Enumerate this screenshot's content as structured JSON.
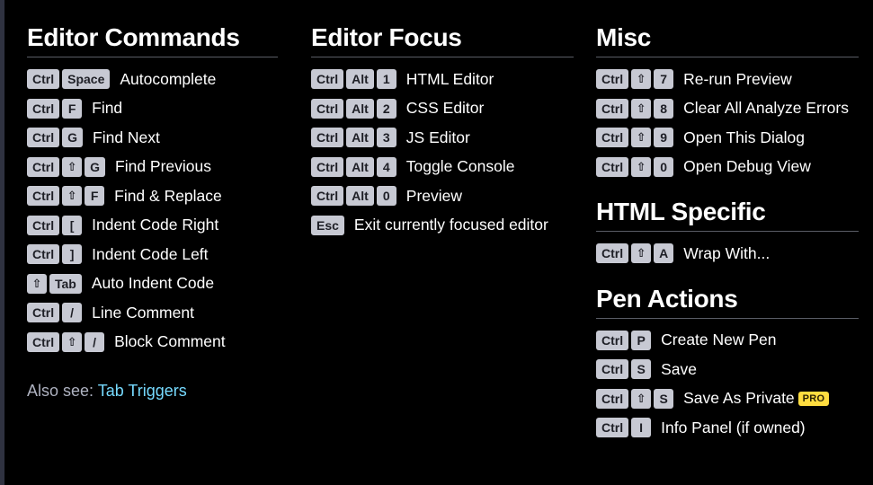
{
  "colors": {
    "background": "#000000",
    "key_bg": "#c7c9d3",
    "key_text": "#1e1f26",
    "link": "#76daff",
    "pro_badge": "#ffdd40"
  },
  "sections": {
    "editor_commands": {
      "title": "Editor Commands",
      "rows": [
        {
          "keys": [
            "Ctrl",
            "Space"
          ],
          "label": "Autocomplete"
        },
        {
          "keys": [
            "Ctrl",
            "F"
          ],
          "label": "Find"
        },
        {
          "keys": [
            "Ctrl",
            "G"
          ],
          "label": "Find Next"
        },
        {
          "keys": [
            "Ctrl",
            "⇧",
            "G"
          ],
          "label": "Find Previous"
        },
        {
          "keys": [
            "Ctrl",
            "⇧",
            "F"
          ],
          "label": "Find & Replace"
        },
        {
          "keys": [
            "Ctrl",
            "["
          ],
          "label": "Indent Code Right"
        },
        {
          "keys": [
            "Ctrl",
            "]"
          ],
          "label": "Indent Code Left"
        },
        {
          "keys": [
            "⇧",
            "Tab"
          ],
          "label": "Auto Indent Code"
        },
        {
          "keys": [
            "Ctrl",
            "/"
          ],
          "label": "Line Comment"
        },
        {
          "keys": [
            "Ctrl",
            "⇧",
            "/"
          ],
          "label": "Block Comment"
        }
      ]
    },
    "editor_focus": {
      "title": "Editor Focus",
      "rows": [
        {
          "keys": [
            "Ctrl",
            "Alt",
            "1"
          ],
          "label": "HTML Editor"
        },
        {
          "keys": [
            "Ctrl",
            "Alt",
            "2"
          ],
          "label": "CSS Editor"
        },
        {
          "keys": [
            "Ctrl",
            "Alt",
            "3"
          ],
          "label": "JS Editor"
        },
        {
          "keys": [
            "Ctrl",
            "Alt",
            "4"
          ],
          "label": "Toggle Console"
        },
        {
          "keys": [
            "Ctrl",
            "Alt",
            "0"
          ],
          "label": "Preview"
        },
        {
          "keys": [
            "Esc"
          ],
          "label": "Exit currently focused editor"
        }
      ]
    },
    "misc": {
      "title": "Misc",
      "rows": [
        {
          "keys": [
            "Ctrl",
            "⇧",
            "7"
          ],
          "label": "Re-run Preview"
        },
        {
          "keys": [
            "Ctrl",
            "⇧",
            "8"
          ],
          "label": "Clear All Analyze Errors"
        },
        {
          "keys": [
            "Ctrl",
            "⇧",
            "9"
          ],
          "label": "Open This Dialog"
        },
        {
          "keys": [
            "Ctrl",
            "⇧",
            "0"
          ],
          "label": "Open Debug View"
        }
      ]
    },
    "html_specific": {
      "title": "HTML Specific",
      "rows": [
        {
          "keys": [
            "Ctrl",
            "⇧",
            "A"
          ],
          "label": "Wrap With..."
        }
      ]
    },
    "pen_actions": {
      "title": "Pen Actions",
      "rows": [
        {
          "keys": [
            "Ctrl",
            "P"
          ],
          "label": "Create New Pen"
        },
        {
          "keys": [
            "Ctrl",
            "S"
          ],
          "label": "Save"
        },
        {
          "keys": [
            "Ctrl",
            "⇧",
            "S"
          ],
          "label": "Save As Private",
          "badge": "PRO"
        },
        {
          "keys": [
            "Ctrl",
            "I"
          ],
          "label": "Info Panel (if owned)"
        }
      ]
    }
  },
  "also_see": {
    "prefix": "Also see:",
    "link_label": "Tab Triggers"
  }
}
